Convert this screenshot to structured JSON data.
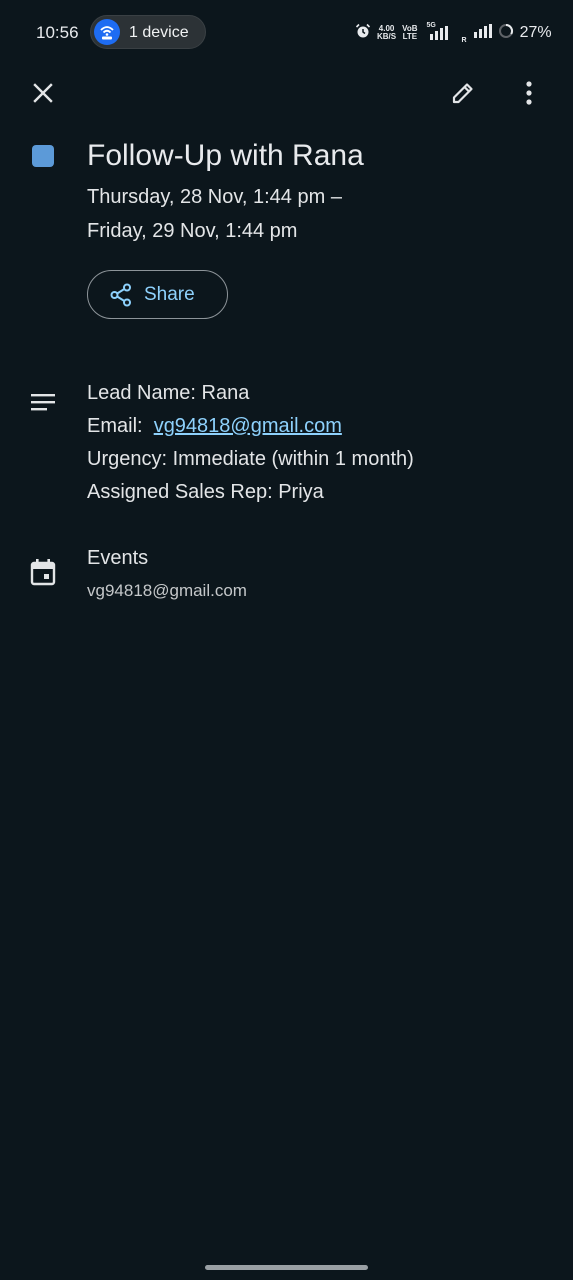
{
  "status_bar": {
    "time": "10:56",
    "hotspot_label": "1 device",
    "net_speed_value": "4.00",
    "net_speed_unit": "KB/S",
    "volte_top": "VoB",
    "volte_bottom": "LTE",
    "network_type": "5G",
    "roaming": "R",
    "battery": "27%",
    "icons": [
      "hotspot-icon",
      "alarm-icon",
      "signal-icon",
      "signal-icon",
      "battery-icon"
    ]
  },
  "toolbar": {
    "icons": [
      "close-icon",
      "edit-icon",
      "more-vert-icon"
    ]
  },
  "event": {
    "color": "#5c9ad8",
    "title": "Follow-Up with Rana",
    "start": "Thursday, 28 Nov, 1:44 pm –",
    "end": "Friday, 29 Nov, 1:44 pm",
    "share_label": "Share"
  },
  "description": {
    "lead_label": "Lead Name:  Rana",
    "email_label": "Email:  ",
    "email_value": "vg94818@gmail.com",
    "urgency_label": "Urgency:  Immediate (within 1 month)",
    "rep_label": "Assigned Sales Rep: Priya"
  },
  "calendar": {
    "name": "Events",
    "account": "vg94818@gmail.com"
  },
  "colors": {
    "background": "#0c161c",
    "accent": "#8ed1fc",
    "hotspot": "#1e6cf2"
  }
}
